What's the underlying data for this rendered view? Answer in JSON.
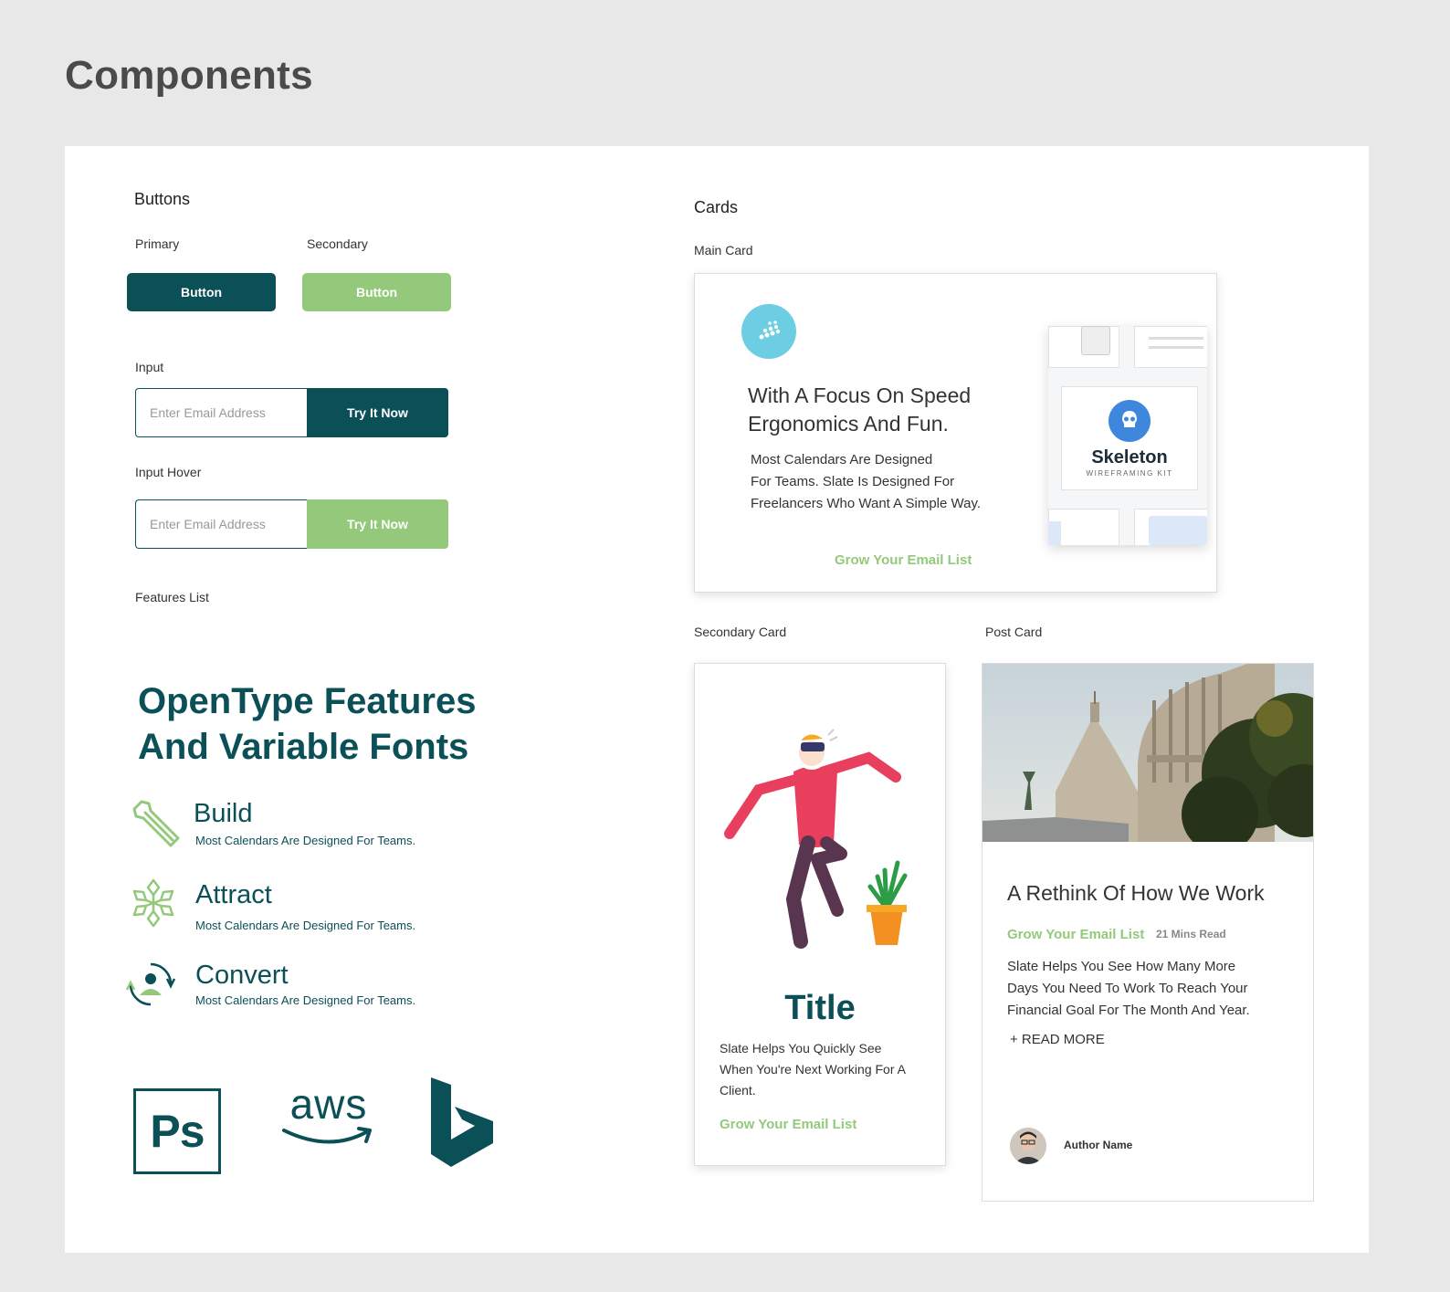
{
  "page": {
    "title": "Components"
  },
  "buttons": {
    "heading": "Buttons",
    "primary_label": "Primary",
    "secondary_label": "Secondary",
    "primary_button": "Button",
    "secondary_button": "Button"
  },
  "inputs": {
    "input_label": "Input",
    "hover_label": "Input Hover",
    "placeholder": "Enter Email Address",
    "button": "Try It Now"
  },
  "features": {
    "label": "Features List",
    "title_line1": "OpenType Features",
    "title_line2": "And Variable Fonts",
    "items": [
      {
        "title": "Build",
        "desc": "Most Calendars Are Designed For Teams.",
        "icon": "wrench-icon"
      },
      {
        "title": "Attract",
        "desc": "Most Calendars Are Designed For Teams.",
        "icon": "snowflake-icon"
      },
      {
        "title": "Convert",
        "desc": "Most Calendars Are Designed For Teams.",
        "icon": "person-cycle-icon"
      }
    ],
    "logos": [
      "photoshop-logo",
      "aws-logo",
      "bing-logo"
    ],
    "ps_text": "Ps",
    "aws_text": "aws"
  },
  "cards": {
    "heading": "Cards",
    "main_label": "Main Card",
    "main": {
      "title_line1": "With A Focus On Speed",
      "title_line2": "Ergonomics And Fun.",
      "body_line1": "Most Calendars Are Designed",
      "body_line2": "For Teams. Slate Is Designed For",
      "body_line3": "Freelancers Who Want A Simple Way.",
      "link": "Grow Your Email List",
      "brand": "Skeleton",
      "brand_sub": "WIREFRAMING KIT"
    },
    "secondary_label": "Secondary Card",
    "secondary": {
      "title": "Title",
      "body_line1": "Slate Helps You Quickly See",
      "body_line2": "When You're Next Working For A",
      "body_line3": "Client.",
      "link": "Grow Your Email List"
    },
    "post_label": "Post Card",
    "post": {
      "title": "A Rethink Of How We Work",
      "link": "Grow Your Email List",
      "read_time": "21 Mins Read",
      "body_line1": "Slate Helps You See How Many More",
      "body_line2": "Days You Need To Work To Reach Your",
      "body_line3": "Financial Goal For The Month And Year.",
      "read_more": "+ READ MORE",
      "author": "Author Name"
    }
  },
  "colors": {
    "primary": "#0b4f57",
    "secondary": "#94c97b",
    "background": "#e8e8e8"
  }
}
